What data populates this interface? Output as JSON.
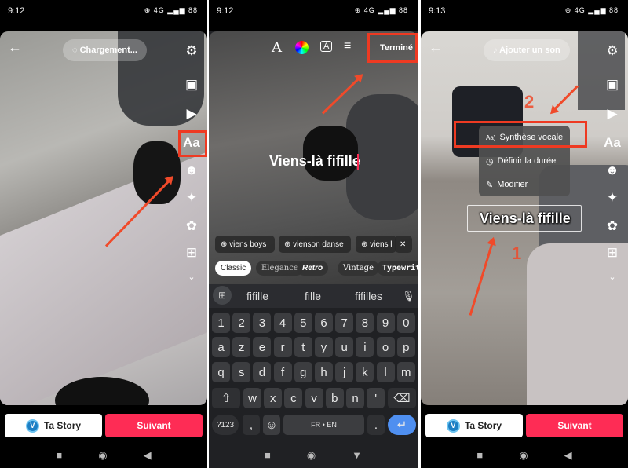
{
  "panels": [
    {
      "time": "9:12",
      "status_icons": "⊕ 4G ▂▄▆ 88",
      "loading_pill": "Chargement...",
      "text_tool_label": "Aa",
      "story_button": "Ta Story",
      "avatar_letter": "V",
      "next_button": "Suivant"
    },
    {
      "time": "9:12",
      "status_icons": "⊕ 4G ▂▄▆ 88",
      "toolbar": {
        "font": "A",
        "text_bg": "A",
        "align": "≡",
        "done": "Terminé"
      },
      "typed_text": "Viens-là fifille",
      "suggestions": [
        "viens boys",
        "vienson danse",
        "viens l"
      ],
      "styles": [
        "Classic",
        "Elegance",
        "Retro",
        "Vintage",
        "Typewriter"
      ],
      "word_suggestions": [
        "fifille",
        "fille",
        "fifilles"
      ],
      "keyboard": {
        "row1": [
          "1",
          "2",
          "3",
          "4",
          "5",
          "6",
          "7",
          "8",
          "9",
          "0"
        ],
        "row2": [
          "a",
          "z",
          "e",
          "r",
          "t",
          "y",
          "u",
          "i",
          "o",
          "p"
        ],
        "row3": [
          "q",
          "s",
          "d",
          "f",
          "g",
          "h",
          "j",
          "k",
          "l",
          "m"
        ],
        "row4": [
          "w",
          "x",
          "c",
          "v",
          "b",
          "n",
          "'"
        ],
        "symbols": "?123",
        "comma": ",",
        "space": "FR • EN",
        "period": "."
      }
    },
    {
      "time": "9:13",
      "status_icons": "⊕ 4G ▂▄▆ 88",
      "add_sound": "Ajouter un son",
      "text_tool_label": "Aa",
      "menu": [
        "Synthèse vocale",
        "Définir la durée",
        "Modifier"
      ],
      "overlay_text": "Viens-là fifille",
      "annotation_1": "1",
      "annotation_2": "2",
      "story_button": "Ta Story",
      "avatar_letter": "V",
      "next_button": "Suivant"
    }
  ],
  "colors": {
    "accent": "#fe2c55",
    "annotation": "#ee3a22",
    "enter_key": "#4f8ff0"
  }
}
